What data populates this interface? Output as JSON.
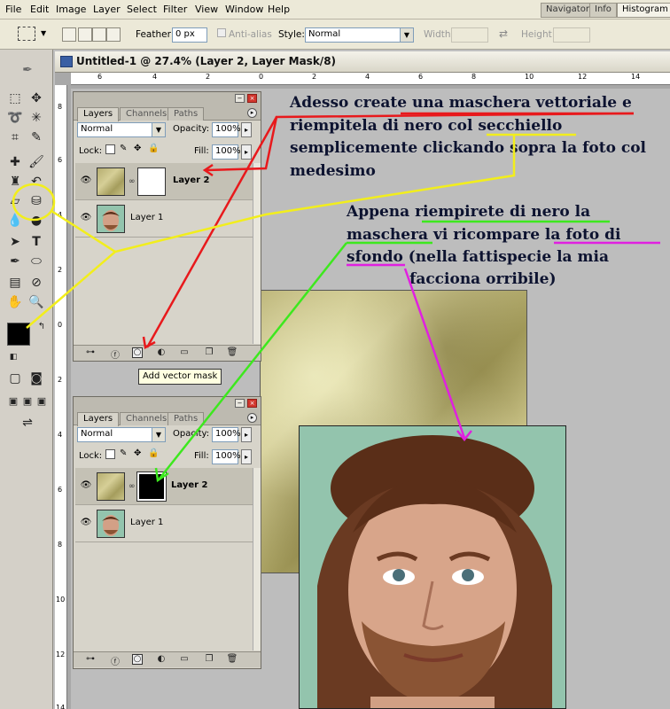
{
  "menubar": {
    "items": [
      "File",
      "Edit",
      "Image",
      "Layer",
      "Select",
      "Filter",
      "View",
      "Window",
      "Help"
    ],
    "palette_tabs": [
      "Navigator",
      "Info",
      "Histogram"
    ]
  },
  "options_bar": {
    "feather_label": "Feather:",
    "feather_value": "0 px",
    "antialias_label": "Anti-alias",
    "style_label": "Style:",
    "style_value": "Normal",
    "width_label": "Width:",
    "height_label": "Height:"
  },
  "document": {
    "title": "Untitled-1 @ 27.4% (Layer 2, Layer Mask/8)",
    "ruler_top": [
      "6",
      "4",
      "2",
      "0",
      "2",
      "4",
      "6",
      "8",
      "10",
      "12",
      "14"
    ],
    "ruler_left": [
      "8",
      "6",
      "4",
      "2",
      "0",
      "2",
      "4",
      "6",
      "8",
      "10",
      "12",
      "14"
    ]
  },
  "layers_panel": {
    "tabs": [
      "Layers",
      "Channels",
      "Paths"
    ],
    "blend_mode": "Normal",
    "opacity_label": "Opacity:",
    "opacity_value": "100%",
    "lock_label": "Lock:",
    "fill_label": "Fill:",
    "fill_value": "100%",
    "layers": [
      "Layer 2",
      "Layer 1"
    ]
  },
  "tooltip": "Add vector mask",
  "annotations": {
    "top": [
      "Adesso create una maschera vettoriale e",
      "riempitela di nero col secchiello",
      "semplicemente clickando sopra la foto col",
      "medesimo"
    ],
    "middle": [
      "Appena riempirete di nero la",
      "maschera vi ricompare la foto di",
      "sfondo  (nella fattispecie la mia",
      "facciona orribile)"
    ]
  },
  "colors": {
    "arrow_red": "#e8191c",
    "arrow_yellow": "#f2ee1c",
    "arrow_green": "#3de81e",
    "arrow_magenta": "#e020e0"
  }
}
